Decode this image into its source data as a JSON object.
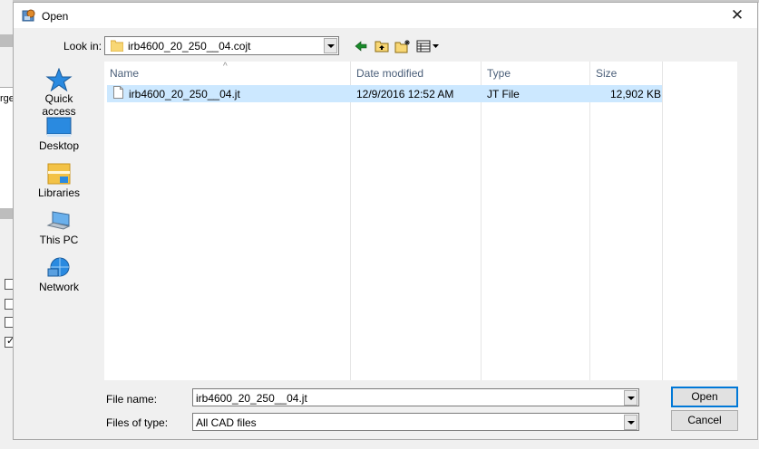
{
  "dialog": {
    "title": "Open",
    "close_glyph": "✕"
  },
  "lookin": {
    "label": "Look in:",
    "value": "irb4600_20_250__04.cojt",
    "icons": [
      "back-icon",
      "up-folder-icon",
      "new-folder-icon",
      "view-menu-icon"
    ]
  },
  "places": [
    {
      "label": "Quick access",
      "icon": "star-icon"
    },
    {
      "label": "Desktop",
      "icon": "desktop-icon"
    },
    {
      "label": "Libraries",
      "icon": "libraries-icon"
    },
    {
      "label": "This PC",
      "icon": "computer-icon"
    },
    {
      "label": "Network",
      "icon": "network-icon"
    }
  ],
  "columns": [
    "Name",
    "Date modified",
    "Type",
    "Size"
  ],
  "files": [
    {
      "name": "irb4600_20_250__04.jt",
      "date": "12/9/2016 12:52 AM",
      "type": "JT File",
      "size": "12,902 KB"
    }
  ],
  "filename": {
    "label": "File name:",
    "value": "irb4600_20_250__04.jt"
  },
  "filetype": {
    "label": "Files of type:",
    "value": "All CAD files"
  },
  "buttons": {
    "open": "Open",
    "cancel": "Cancel"
  },
  "background": {
    "fragment": "rge",
    "checkmark": "✓"
  }
}
